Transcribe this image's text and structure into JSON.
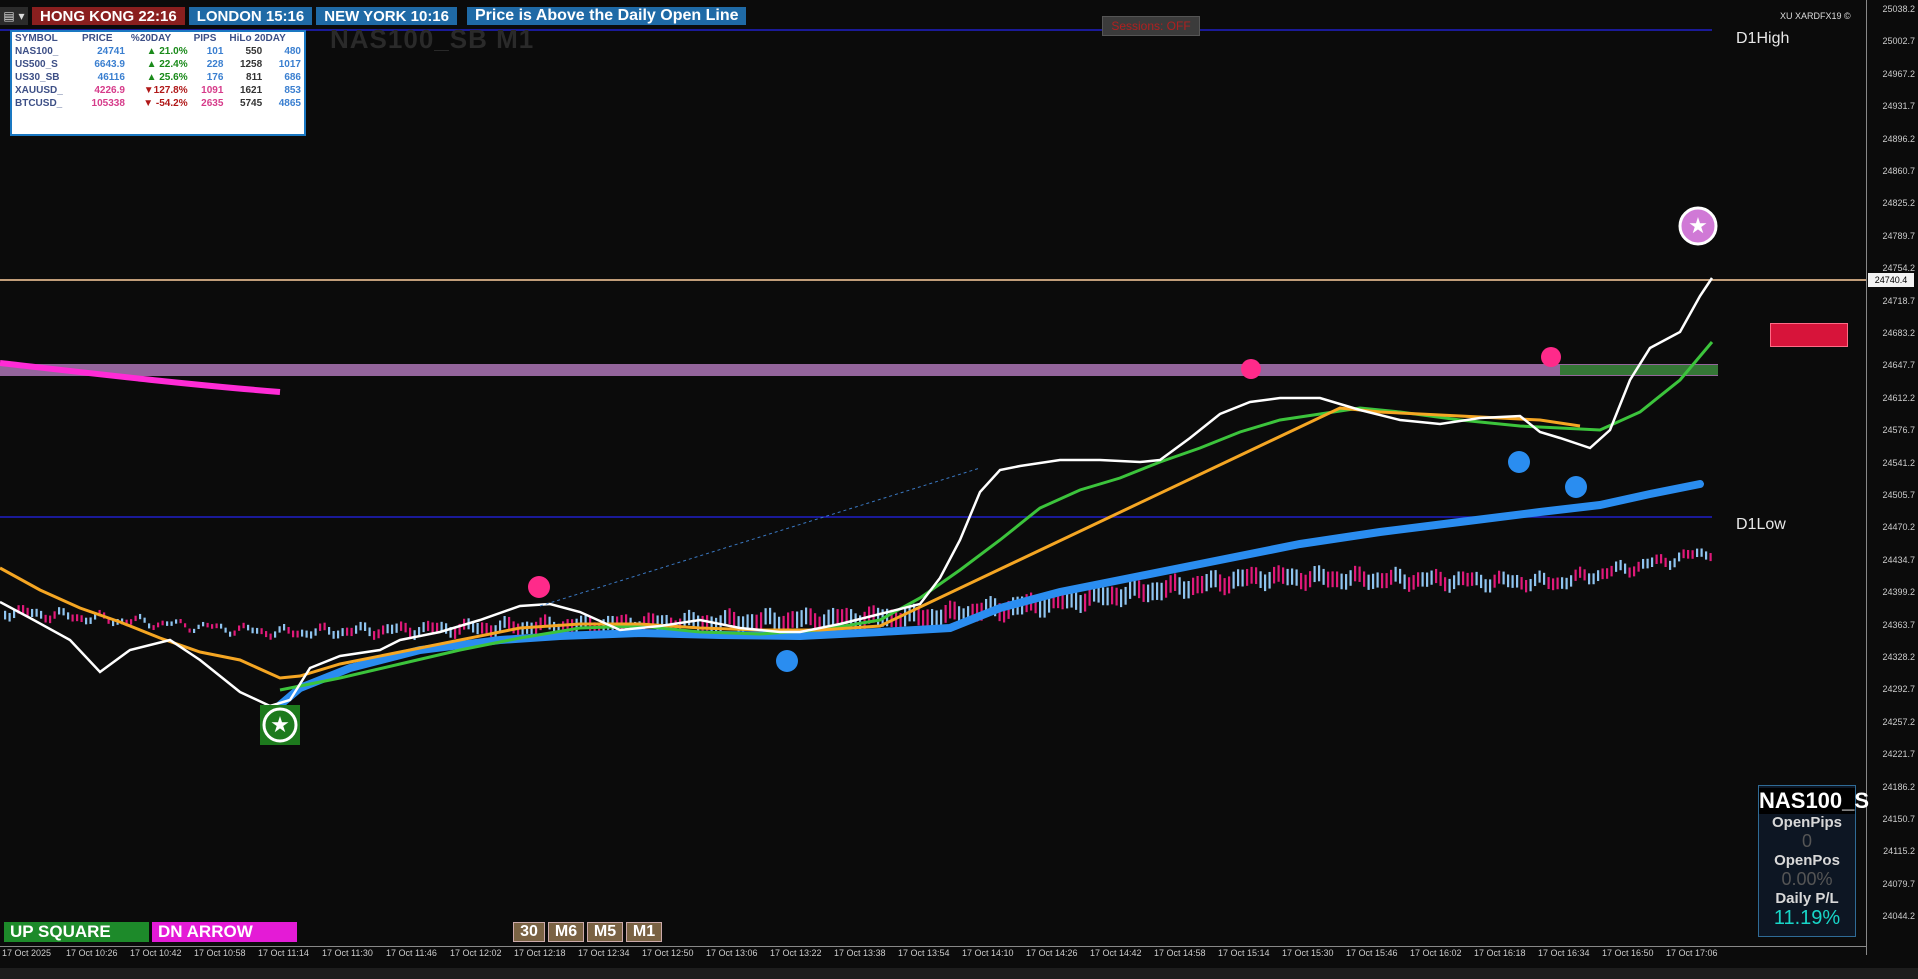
{
  "header": {
    "menu_icon": "menu-icon",
    "clocks": [
      {
        "label": "HONG KONG 22:16"
      },
      {
        "label": "LONDON 15:16"
      },
      {
        "label": "NEW YORK 10:16"
      }
    ],
    "message": "Price is Above the Daily Open Line"
  },
  "ticker_table": {
    "headers": [
      "SYMBOL",
      "PRICE",
      "%20DAY",
      "PIPS",
      "HiLo 20DAY"
    ],
    "rows": [
      {
        "symbol": "NAS100_",
        "price": "24741",
        "pct": "▲ 21.0%",
        "pips": "101",
        "hi": "550",
        "lo": "480",
        "price_color": "#3a7fd0",
        "pct_color": "#1a8a1a"
      },
      {
        "symbol": "US500_S",
        "price": "6643.9",
        "pct": "▲ 22.4%",
        "pips": "228",
        "hi": "1258",
        "lo": "1017",
        "price_color": "#3a7fd0",
        "pct_color": "#1a8a1a"
      },
      {
        "symbol": "US30_SB",
        "price": "46116",
        "pct": "▲ 25.6%",
        "pips": "176",
        "hi": "811",
        "lo": "686",
        "price_color": "#3a7fd0",
        "pct_color": "#1a8a1a"
      },
      {
        "symbol": "XAUUSD_",
        "price": "4226.9",
        "pct": "▼127.8%",
        "pips": "1091",
        "hi": "1621",
        "lo": "853",
        "price_color": "#d63b8a",
        "pct_color": "#b01818"
      },
      {
        "symbol": "BTCUSD_",
        "price": "105338",
        "pct": "▼ -54.2%",
        "pips": "2635",
        "hi": "5745",
        "lo": "4865",
        "price_color": "#d63b8a",
        "pct_color": "#b01818"
      }
    ]
  },
  "watermark": "NAS100_SB M1",
  "sessions_button": "Sessions: OFF",
  "broker_label": "XU XARDFX19 ©",
  "levels": {
    "d1_high": "D1High",
    "d1_low": "D1Low"
  },
  "current_price": "24740.4",
  "price_axis": [
    "25038.2",
    "25002.7",
    "24967.2",
    "24931.7",
    "24896.2",
    "24860.7",
    "24825.2",
    "24789.7",
    "24754.2",
    "24718.7",
    "24683.2",
    "24647.7",
    "24612.2",
    "24576.7",
    "24541.2",
    "24505.7",
    "24470.2",
    "24434.7",
    "24399.2",
    "24363.7",
    "24328.2",
    "24292.7",
    "24257.2",
    "24221.7",
    "24186.2",
    "24150.7",
    "24115.2",
    "24079.7",
    "24044.2"
  ],
  "time_axis": [
    "17 Oct 2025",
    "17 Oct 10:26",
    "17 Oct 10:42",
    "17 Oct 10:58",
    "17 Oct 11:14",
    "17 Oct 11:30",
    "17 Oct 11:46",
    "17 Oct 12:02",
    "17 Oct 12:18",
    "17 Oct 12:34",
    "17 Oct 12:50",
    "17 Oct 13:06",
    "17 Oct 13:22",
    "17 Oct 13:38",
    "17 Oct 13:54",
    "17 Oct 14:10",
    "17 Oct 14:26",
    "17 Oct 14:42",
    "17 Oct 14:58",
    "17 Oct 15:14",
    "17 Oct 15:30",
    "17 Oct 15:46",
    "17 Oct 16:02",
    "17 Oct 16:18",
    "17 Oct 16:34",
    "17 Oct 16:50",
    "17 Oct 17:06"
  ],
  "account_panel": {
    "symbol": "NAS100_S",
    "open_pips_label": "OpenPips",
    "open_pips_value": "0",
    "open_pos_label": "OpenPos",
    "open_pos_value": "0.00%",
    "daily_pl_label": "Daily P/L",
    "daily_pl_value": "11.19%"
  },
  "buttons": {
    "up_square": "UP SQUARE",
    "dn_arrow": "DN ARROW"
  },
  "timeframes": [
    "30",
    "M6",
    "M5",
    "M1"
  ],
  "colors": {
    "background": "#0b0b0b",
    "ema_white": "#ffffff",
    "ema_orange": "#f5a623",
    "ema_green": "#3cc43c",
    "ema_blue": "#2a8df0",
    "magenta_line": "#ff2bd6",
    "zone": "#b77cc0",
    "level_line": "#2020c8",
    "price_line": "#ffd0a0"
  }
}
